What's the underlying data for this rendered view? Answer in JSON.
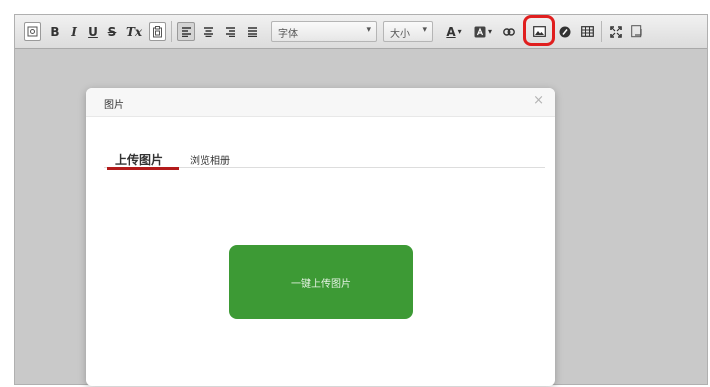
{
  "toolbar": {
    "bold": "B",
    "italic": "I",
    "underline": "U",
    "strikethrough": "S",
    "clear_format": "Tx",
    "font_family_label": "字体",
    "font_size_label": "大小",
    "font_color": "A",
    "caret": "▾",
    "accent_highlight": "#e01f1f"
  },
  "dialog": {
    "title": "图片",
    "close": "×",
    "tabs": [
      {
        "label": "上传图片",
        "active": true
      },
      {
        "label": "浏览相册",
        "active": false
      }
    ],
    "upload_button_label": "一键上传图片",
    "upload_button_color": "#3d9a35",
    "tab_underline_color": "#b31b1b"
  }
}
